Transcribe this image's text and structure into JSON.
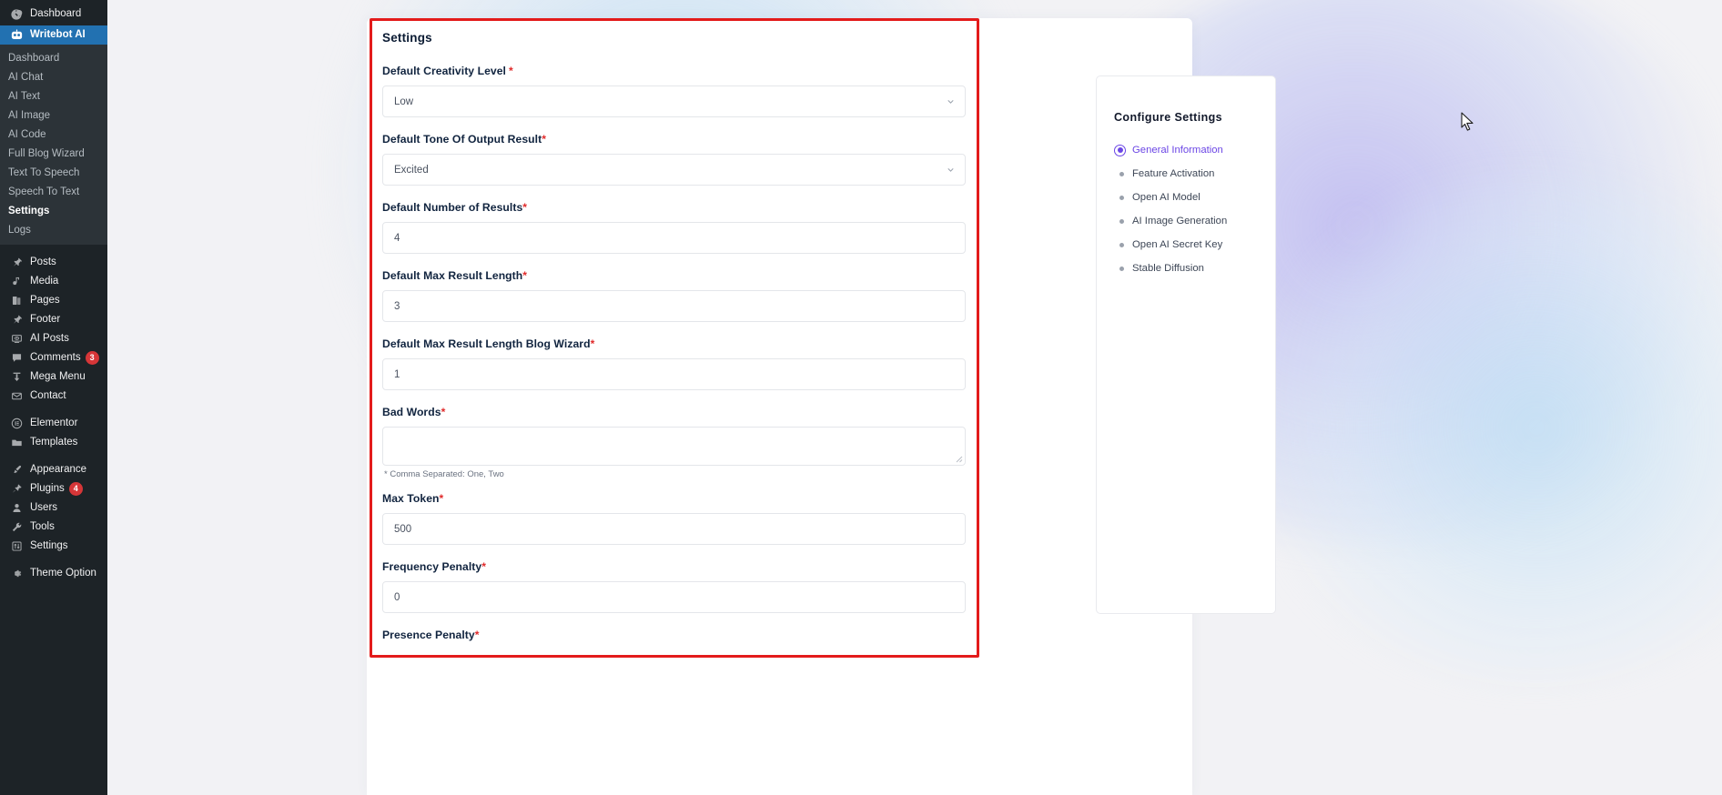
{
  "wp_sidebar": {
    "top_items": [
      {
        "label": "Dashboard",
        "icon": "dashboard-icon",
        "badge": null
      }
    ],
    "current_menu": {
      "label": "Writebot AI",
      "icon": "robot-icon"
    },
    "submenu": [
      {
        "label": "Dashboard",
        "active": false
      },
      {
        "label": "AI Chat",
        "active": false
      },
      {
        "label": "AI Text",
        "active": false
      },
      {
        "label": "AI Image",
        "active": false
      },
      {
        "label": "AI Code",
        "active": false
      },
      {
        "label": "Full Blog Wizard",
        "active": false
      },
      {
        "label": "Text To Speech",
        "active": false
      },
      {
        "label": "Speech To Text",
        "active": false
      },
      {
        "label": "Settings",
        "active": true
      },
      {
        "label": "Logs",
        "active": false
      }
    ],
    "group_a": [
      {
        "label": "Posts",
        "icon": "pin-icon",
        "badge": null
      },
      {
        "label": "Media",
        "icon": "media-icon",
        "badge": null
      },
      {
        "label": "Pages",
        "icon": "pages-icon",
        "badge": null
      },
      {
        "label": "Footer",
        "icon": "pin-icon",
        "badge": null
      },
      {
        "label": "AI Posts",
        "icon": "screen-icon",
        "badge": null
      },
      {
        "label": "Comments",
        "icon": "comment-icon",
        "badge": "3"
      },
      {
        "label": "Mega Menu",
        "icon": "download-icon",
        "badge": null
      },
      {
        "label": "Contact",
        "icon": "envelope-icon",
        "badge": null
      }
    ],
    "group_b": [
      {
        "label": "Elementor",
        "icon": "elementor-icon",
        "badge": null
      },
      {
        "label": "Templates",
        "icon": "folder-icon",
        "badge": null
      }
    ],
    "group_c": [
      {
        "label": "Appearance",
        "icon": "brush-icon",
        "badge": null
      },
      {
        "label": "Plugins",
        "icon": "plug-icon",
        "badge": "4"
      },
      {
        "label": "Users",
        "icon": "user-icon",
        "badge": null
      },
      {
        "label": "Tools",
        "icon": "wrench-icon",
        "badge": null
      },
      {
        "label": "Settings",
        "icon": "sliders-icon",
        "badge": null
      }
    ],
    "group_d": [
      {
        "label": "Theme Option",
        "icon": "gear-icon",
        "badge": null
      }
    ]
  },
  "settings_form": {
    "title": "Settings",
    "fields": [
      {
        "label": "Default Creativity Level",
        "required_mark": "*",
        "required_spaced": true,
        "type": "select",
        "value": "Low"
      },
      {
        "label": "Default Tone Of Output Result",
        "required_mark": "*",
        "required_spaced": false,
        "type": "select",
        "value": "Excited"
      },
      {
        "label": "Default Number of Results",
        "required_mark": "*",
        "required_spaced": false,
        "type": "text",
        "value": "4"
      },
      {
        "label": "Default Max Result Length",
        "required_mark": "*",
        "required_spaced": false,
        "type": "text",
        "value": "3"
      },
      {
        "label": "Default Max Result Length Blog Wizard",
        "required_mark": "*",
        "required_spaced": false,
        "type": "text",
        "value": "1"
      },
      {
        "label": "Bad Words",
        "required_mark": "*",
        "required_spaced": false,
        "type": "textarea",
        "value": "",
        "help": "* Comma Separated: One, Two"
      },
      {
        "label": "Max Token",
        "required_mark": "*",
        "required_spaced": false,
        "type": "text",
        "value": "500"
      },
      {
        "label": "Frequency Penalty",
        "required_mark": "*",
        "required_spaced": false,
        "type": "text",
        "value": "0"
      },
      {
        "label": "Presence Penalty",
        "required_mark": "*",
        "required_spaced": false,
        "type": "text",
        "value": ""
      }
    ]
  },
  "configure_panel": {
    "title": "Configure Settings",
    "items": [
      {
        "label": "General Information",
        "active": true
      },
      {
        "label": "Feature Activation",
        "active": false
      },
      {
        "label": "Open AI Model",
        "active": false
      },
      {
        "label": "AI Image Generation",
        "active": false
      },
      {
        "label": "Open AI Secret Key",
        "active": false
      },
      {
        "label": "Stable Diffusion",
        "active": false
      }
    ]
  },
  "colors": {
    "wp_sidebar_bg": "#1d2327",
    "wp_current_blue": "#2271b1",
    "badge_red": "#d63638",
    "highlight_red": "#e31b1b",
    "accent_purple": "#6b46e5",
    "label_navy": "#11243f",
    "required_red": "#e02b2b"
  }
}
